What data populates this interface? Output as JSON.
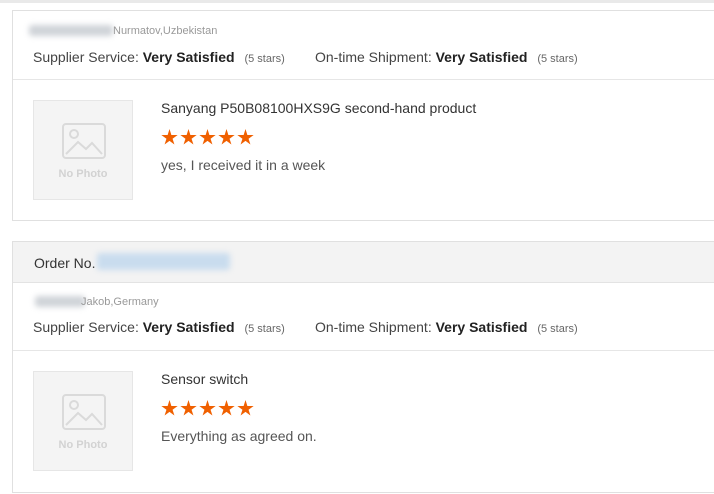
{
  "reviews": [
    {
      "buyer": "Nurmatov,Uzbekistan",
      "supplier_label": "Supplier Service:",
      "supplier_value": "Very Satisfied",
      "supplier_stars": "(5 stars)",
      "shipment_label": "On-time Shipment:",
      "shipment_value": "Very Satisfied",
      "shipment_stars": "(5 stars)",
      "product": "Sanyang P50B08100HXS9G second-hand product",
      "rating": 5,
      "comment": "yes, I received it in a week",
      "photo_placeholder": "No Photo"
    },
    {
      "order_label": "Order No.",
      "buyer": "Jakob,Germany",
      "supplier_label": "Supplier Service:",
      "supplier_value": "Very Satisfied",
      "supplier_stars": "(5 stars)",
      "shipment_label": "On-time Shipment:",
      "shipment_value": "Very Satisfied",
      "shipment_stars": "(5 stars)",
      "product": "Sensor switch",
      "rating": 5,
      "comment": "Everything as agreed on.",
      "photo_placeholder": "No Photo"
    }
  ],
  "colors": {
    "star": "#f06000",
    "order_bar": "#f3f3f3"
  }
}
